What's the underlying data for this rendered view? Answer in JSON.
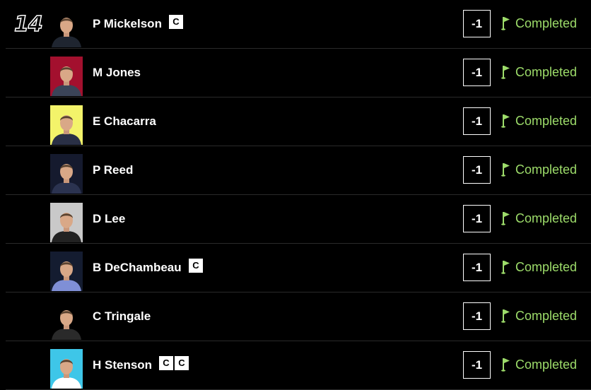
{
  "colors": {
    "background": "#000000",
    "text": "#ffffff",
    "status_green": "#9ddc6a",
    "divider": "#2a2a2a"
  },
  "group": {
    "position": "14"
  },
  "players": [
    {
      "name": "P Mickelson",
      "badges": [
        "C"
      ],
      "score": "-1",
      "status": "Completed",
      "photo_bg": "#000000",
      "shirt": "#1f2530"
    },
    {
      "name": "M Jones",
      "badges": [],
      "score": "-1",
      "status": "Completed",
      "photo_bg": "#a3102e",
      "shirt": "#3b4458"
    },
    {
      "name": "E Chacarra",
      "badges": [],
      "score": "-1",
      "status": "Completed",
      "photo_bg": "#f3f36a",
      "shirt": "#2a3046"
    },
    {
      "name": "P Reed",
      "badges": [],
      "score": "-1",
      "status": "Completed",
      "photo_bg": "#151a2e",
      "shirt": "#2b3350"
    },
    {
      "name": "D Lee",
      "badges": [],
      "score": "-1",
      "status": "Completed",
      "photo_bg": "#c9c9c9",
      "shirt": "#222222"
    },
    {
      "name": "B DeChambeau",
      "badges": [
        "C"
      ],
      "score": "-1",
      "status": "Completed",
      "photo_bg": "#141c30",
      "shirt": "#7f8fd6"
    },
    {
      "name": "C Tringale",
      "badges": [],
      "score": "-1",
      "status": "Completed",
      "photo_bg": "#000000",
      "shirt": "#2a2a2a"
    },
    {
      "name": "H Stenson",
      "badges": [
        "C",
        "C"
      ],
      "score": "-1",
      "status": "Completed",
      "photo_bg": "#3ec6e8",
      "shirt": "#ffffff"
    }
  ],
  "icons": {
    "flag": "flag-icon",
    "captain_badge": "captain-badge"
  }
}
